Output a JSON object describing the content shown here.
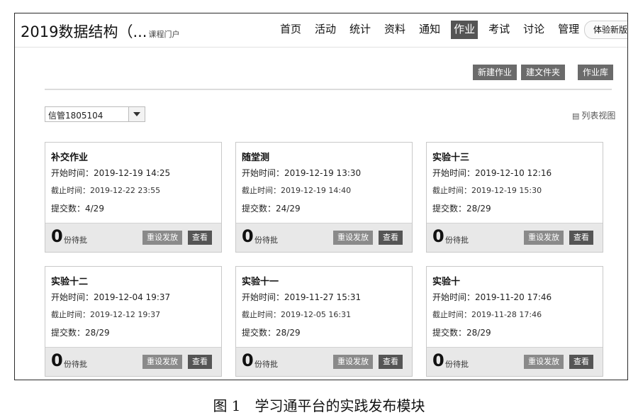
{
  "header": {
    "course_title": "2019数据结构（...",
    "course_subtitle": "课程门户",
    "nav": [
      "首页",
      "活动",
      "统计",
      "资料",
      "通知",
      "作业",
      "考试",
      "讨论",
      "管理"
    ],
    "active_nav": "作业",
    "try_new": "体验新版"
  },
  "toolbar": {
    "new_homework": "新建作业",
    "new_folder": "建文件夹",
    "homework_library": "作业库"
  },
  "filter": {
    "class_selected": "信管1805104",
    "list_view": "列表视图",
    "list_view_icon": "list-icon"
  },
  "cards": [
    {
      "title": "补交作业",
      "start": "开始时间：2019-12-19 14:25",
      "deadline": "截止时间：2019-12-22 23:55",
      "submitted": "提交数：4/29",
      "pending_count": "0",
      "pending_label": "份待批",
      "reset": "重设发放",
      "view": "查看"
    },
    {
      "title": "随堂测",
      "start": "开始时间：2019-12-19 13:30",
      "deadline": "截止时间：2019-12-19 14:40",
      "submitted": "提交数：24/29",
      "pending_count": "0",
      "pending_label": "份待批",
      "reset": "重设发放",
      "view": "查看"
    },
    {
      "title": "实验十三",
      "start": "开始时间：2019-12-10 12:16",
      "deadline": "截止时间：2019-12-19 15:30",
      "submitted": "提交数：28/29",
      "pending_count": "0",
      "pending_label": "份待批",
      "reset": "重设发放",
      "view": "查看"
    },
    {
      "title": "实验十二",
      "start": "开始时间：2019-12-04 19:37",
      "deadline": "截止时间：2019-12-12 19:37",
      "submitted": "提交数：28/29",
      "pending_count": "0",
      "pending_label": "份待批",
      "reset": "重设发放",
      "view": "查看"
    },
    {
      "title": "实验十一",
      "start": "开始时间：2019-11-27 15:31",
      "deadline": "截止时间：2019-12-05 16:31",
      "submitted": "提交数：28/29",
      "pending_count": "0",
      "pending_label": "份待批",
      "reset": "重设发放",
      "view": "查看"
    },
    {
      "title": "实验十",
      "start": "开始时间：2019-11-20 17:46",
      "deadline": "截止时间：2019-11-28 17:46",
      "submitted": "提交数：28/29",
      "pending_count": "0",
      "pending_label": "份待批",
      "reset": "重设发放",
      "view": "查看"
    }
  ],
  "caption": "图 1　学习通平台的实践发布模块"
}
